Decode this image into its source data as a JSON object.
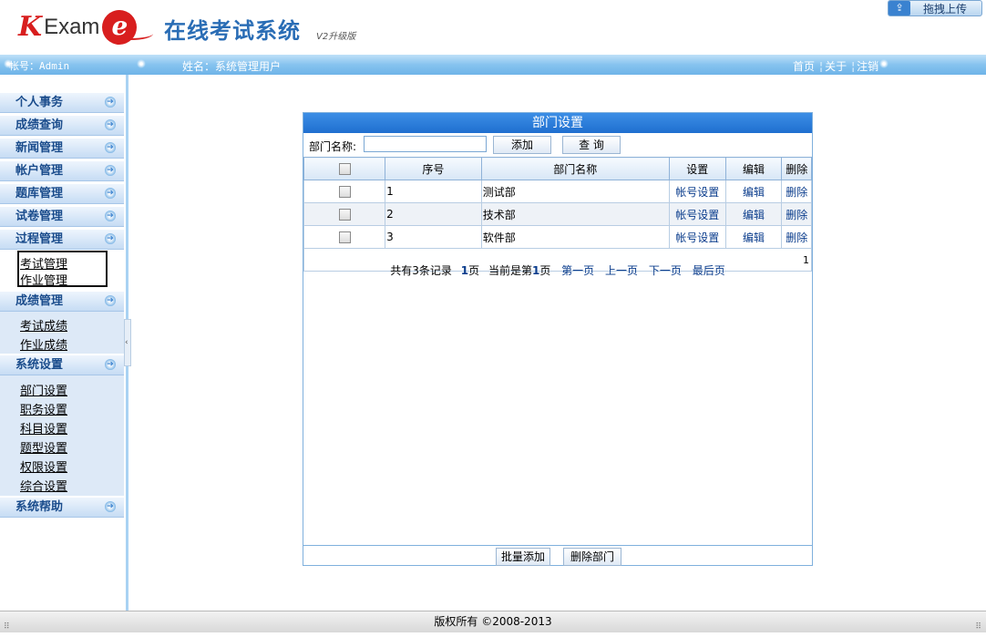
{
  "header": {
    "logo_k": "K",
    "logo_exam": "Exam",
    "logo_e": "e",
    "title": "在线考试系统",
    "version": "V2升级版",
    "upload_label": "拖拽上传"
  },
  "topbar": {
    "account": "帐号：Admin",
    "username": "姓名：系统管理用户",
    "links": [
      "首页",
      "关于",
      "注销"
    ]
  },
  "sidebar": {
    "groups": [
      {
        "label": "个人事务"
      },
      {
        "label": "成绩查询"
      },
      {
        "label": "新闻管理"
      },
      {
        "label": "帐户管理"
      },
      {
        "label": "题库管理"
      },
      {
        "label": "试卷管理"
      },
      {
        "label": "过程管理",
        "items": [
          "考试管理",
          "作业管理"
        ]
      },
      {
        "label": "成绩管理",
        "items": [
          "考试成绩",
          "作业成绩"
        ]
      },
      {
        "label": "系统设置",
        "items": [
          "部门设置",
          "职务设置",
          "科目设置",
          "题型设置",
          "权限设置",
          "综合设置"
        ]
      },
      {
        "label": "系统帮助"
      }
    ]
  },
  "panel": {
    "title": "部门设置",
    "search_label": "部门名称:",
    "search_value": "",
    "add_label": "添加",
    "query_label": "查 询",
    "columns": [
      "序号",
      "部门名称",
      "设置",
      "编辑",
      "删除"
    ],
    "rows": [
      {
        "id": "1",
        "name": "测试部",
        "setting": "帐号设置",
        "edit": "编辑",
        "del": "删除"
      },
      {
        "id": "2",
        "name": "技术部",
        "setting": "帐号设置",
        "edit": "编辑",
        "del": "删除"
      },
      {
        "id": "3",
        "name": "软件部",
        "setting": "帐号设置",
        "edit": "编辑",
        "del": "删除"
      }
    ],
    "page_count": "1",
    "pager": {
      "total_prefix": "共有3条记录",
      "pages_num": "1",
      "pages_suffix": "页",
      "current_prefix": "当前是第",
      "current_num": "1",
      "current_suffix": "页",
      "first": "第一页",
      "prev": "上一页",
      "next": "下一页",
      "last": "最后页"
    },
    "batch_add_label": "批量添加",
    "delete_dept_label": "删除部门"
  },
  "footer": {
    "copyright": "版权所有 ©2008-2013"
  }
}
